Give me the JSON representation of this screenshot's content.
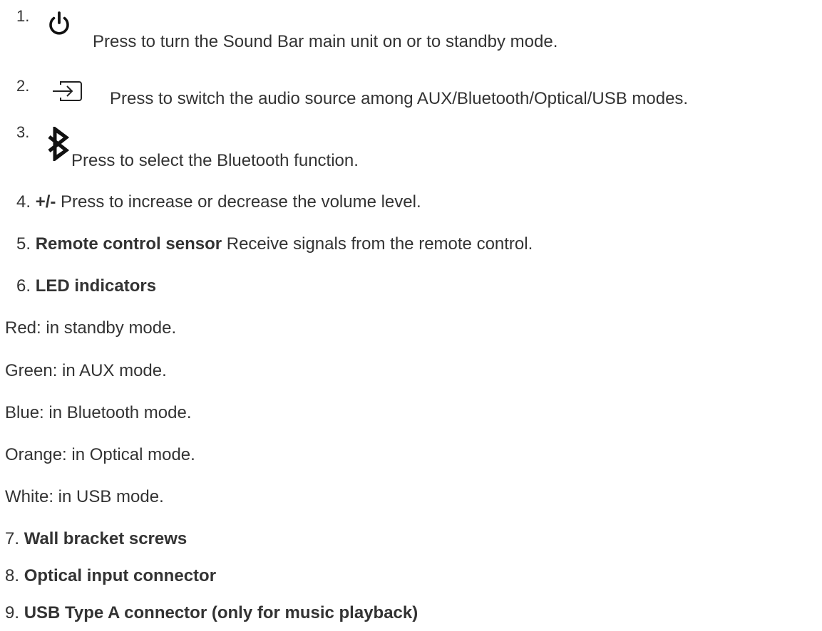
{
  "items": [
    {
      "number": "1.",
      "icon": "power-icon",
      "text": "Press to turn the Sound Bar main unit on or to standby mode."
    },
    {
      "number": "2.",
      "icon": "source-input-icon",
      "text": "Press to switch the audio source among AUX/Bluetooth/Optical/USB modes."
    },
    {
      "number": "3.",
      "icon": "bluetooth-icon",
      "text": "Press to select the Bluetooth function."
    },
    {
      "number": "4.",
      "label": "+/-",
      "text": "Press to increase or decrease the volume level."
    },
    {
      "number": "5.",
      "label": "Remote control sensor",
      "text": "Receive signals from the remote control."
    },
    {
      "number": "6.",
      "label": "LED indicators"
    }
  ],
  "led_states": [
    "Red: in standby mode.",
    "Green: in AUX mode.",
    "Blue: in Bluetooth mode.",
    "Orange: in Optical mode.",
    "White: in USB mode."
  ],
  "parts": [
    {
      "number": "7.",
      "label": "Wall bracket screws"
    },
    {
      "number": "8.",
      "label": "Optical input connector"
    },
    {
      "number": "9.",
      "label": "USB Type A connector (only for music playback)"
    }
  ]
}
